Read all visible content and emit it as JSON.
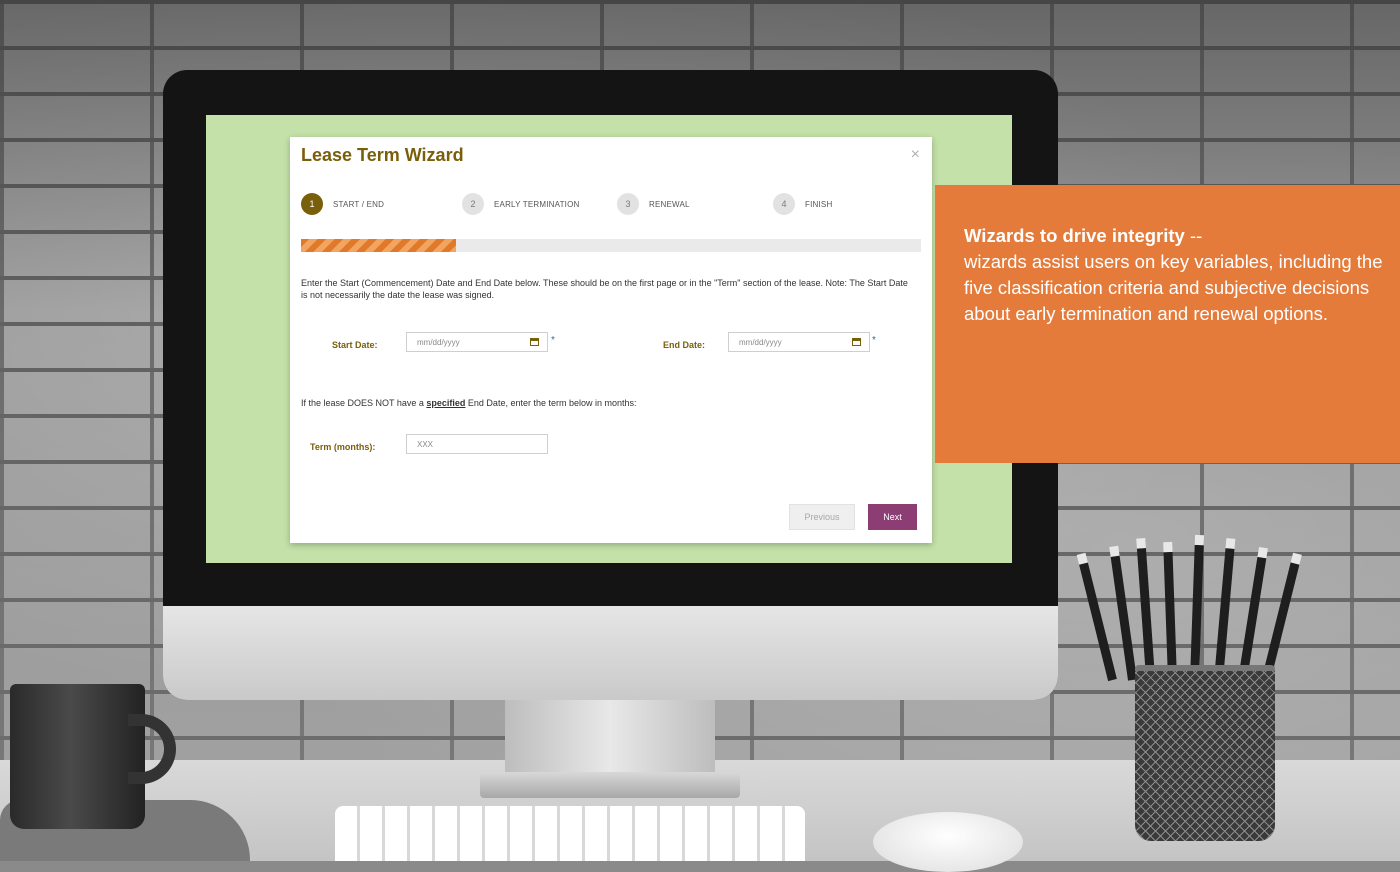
{
  "dialog": {
    "title": "Lease Term Wizard",
    "close_label": "×"
  },
  "steps": [
    {
      "number": "1",
      "label": "START / END",
      "active": true
    },
    {
      "number": "2",
      "label": "EARLY TERMINATION",
      "active": false
    },
    {
      "number": "3",
      "label": "RENEWAL",
      "active": false
    },
    {
      "number": "4",
      "label": "FINISH",
      "active": false
    }
  ],
  "progress": {
    "percent": 25
  },
  "instructions": "Enter the Start (Commencement) Date and End Date below. These should be on the first page or in the \"Term\" section of the lease. Note: The Start Date is not necessarily the date the lease was signed.",
  "start_date": {
    "label": "Start Date:",
    "placeholder": "mm/dd/yyyy",
    "required_mark": "*"
  },
  "end_date": {
    "label": "End Date:",
    "placeholder": "mm/dd/yyyy",
    "required_mark": "*"
  },
  "term_note": {
    "prefix": "If the lease DOES NOT have a ",
    "emphasis": "specified",
    "suffix": " End Date, enter the term below in months:"
  },
  "term": {
    "label": "Term (months):",
    "placeholder": "XXX"
  },
  "buttons": {
    "previous": "Previous",
    "next": "Next"
  },
  "callout": {
    "heading": "Wizards to drive integrity",
    "separator": " --",
    "body": "wizards assist users on key variables, including the five classification criteria and subjective decisions about early termination and renewal options."
  },
  "colors": {
    "title": "#7a5f0a",
    "active_step": "#7a5f0a",
    "progress": "#e07a2a",
    "next_button": "#8b3d74",
    "callout": "#e57b3b",
    "screen_background": "#c3e1a8"
  }
}
